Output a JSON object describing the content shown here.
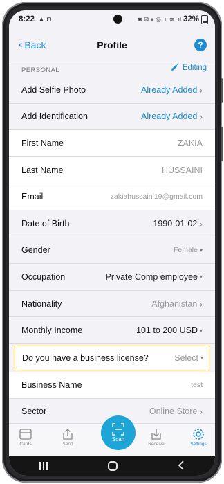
{
  "status_bar": {
    "time": "8:22",
    "left_icons": "▲ ◘",
    "right_icons": "◙ ✉ ¥ ◎ .ıl ≋ .ıl",
    "battery": "32%"
  },
  "nav": {
    "back_label": "Back",
    "title": "Profile",
    "help_label": "?"
  },
  "section": {
    "label": "PERSONAL",
    "edit_label": "Editing"
  },
  "rows": [
    {
      "label": "Add Selfie Photo",
      "value": "Already Added"
    },
    {
      "label": "Add Identification",
      "value": "Already Added"
    },
    {
      "label": "First Name",
      "value": "ZAKIA"
    },
    {
      "label": "Last Name",
      "value": "HUSSAINI"
    },
    {
      "label": "Email",
      "value": "zakiahussaini19@gmail.com"
    },
    {
      "label": "Date of Birth",
      "value": "1990-01-02"
    },
    {
      "label": "Gender",
      "value": "Female"
    },
    {
      "label": "Occupation",
      "value": "Private Comp employee"
    },
    {
      "label": "Nationality",
      "value": "Afghanistan"
    },
    {
      "label": "Monthly Income",
      "value": "101 to 200 USD"
    },
    {
      "label": "Do you have a business license?",
      "value": "Select"
    },
    {
      "label": "Business Name",
      "value": "test"
    },
    {
      "label": "Sector",
      "value": "Online Store"
    }
  ],
  "tabs": {
    "cards": "Cards",
    "send": "Send",
    "scan": "Scan",
    "receive": "Receive",
    "settings": "Settings"
  },
  "colors": {
    "accent": "#1e8bd1",
    "scan_button": "#1ea5d8",
    "highlight_border": "#f2b51c"
  }
}
